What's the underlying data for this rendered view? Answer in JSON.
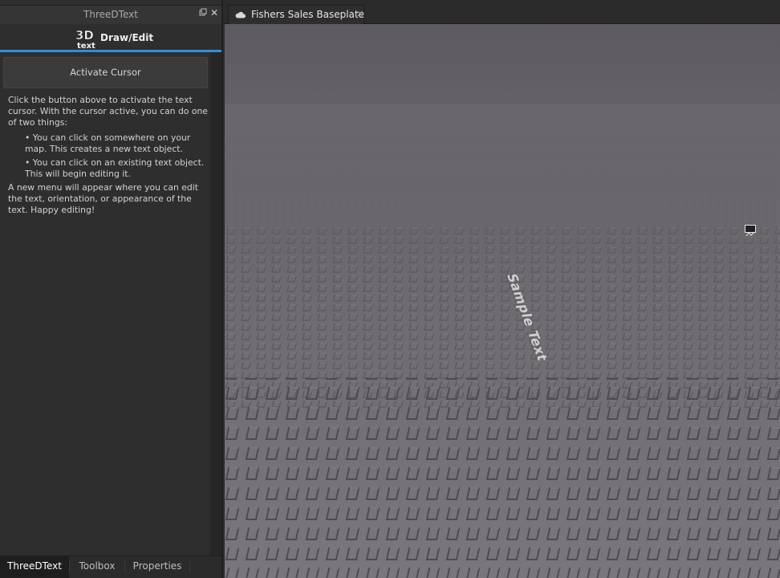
{
  "panel": {
    "title": "ThreeDText",
    "dock_icon": "dock-icon",
    "close_glyph": "✕",
    "logo_text_top": "3D",
    "logo_text_bottom": "text",
    "header_label": "Draw/Edit",
    "accent_color": "#2f8fd8",
    "activate_button": "Activate Cursor",
    "help": {
      "intro": "Click the button above to activate the text cursor. With the cursor active, you can do one of two things:",
      "items": [
        "• You can click on somewhere on your map. This creates a new text object.",
        "• You can click on an existing text object. This will begin editing it."
      ],
      "outro": "A new menu will appear where you can edit the text, orientation, or appearance of the text. Happy editing!"
    }
  },
  "bottom_tabs": [
    {
      "label": "ThreeDText",
      "active": true
    },
    {
      "label": "Toolbox",
      "active": false
    },
    {
      "label": "Properties",
      "active": false
    }
  ],
  "document_tab": {
    "icon": "cloud-icon",
    "title": "Fishers Sales Baseplate",
    "close_glyph": "✕"
  },
  "viewport": {
    "sample_text": "Sample Text",
    "cursor_icon": "text-cursor-icon"
  }
}
